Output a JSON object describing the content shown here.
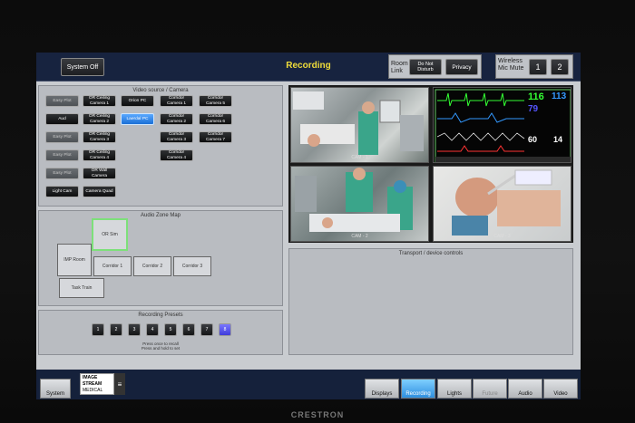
{
  "topbar": {
    "system_off": "System Off",
    "title": "Recording",
    "room_link_label": "Room Link",
    "do_not_disturb": "Do Not Disturb",
    "privacy": "Privacy",
    "wireless_mic_label": "Wireless Mic Mute",
    "mic1": "1",
    "mic2": "2"
  },
  "video_source": {
    "title": "Video source / Camera",
    "buttons": [
      {
        "label": "Easy Plot",
        "state": "dim"
      },
      {
        "label": "OR Ceiling Camera 1",
        "state": "normal"
      },
      {
        "label": "Orion PC",
        "state": "normal"
      },
      {
        "label": "Corridor Camera 1",
        "state": "normal"
      },
      {
        "label": "Corridor Camera 5",
        "state": "normal"
      },
      {
        "label": "Aud",
        "state": "normal"
      },
      {
        "label": "OR Ceiling Camera 2",
        "state": "normal"
      },
      {
        "label": "Laerdal PC",
        "state": "active"
      },
      {
        "label": "Corridor Camera 2",
        "state": "normal"
      },
      {
        "label": "Corridor Camera 6",
        "state": "normal"
      },
      {
        "label": "Easy Plot",
        "state": "dim"
      },
      {
        "label": "OR Ceiling Camera 3",
        "state": "normal"
      },
      {
        "label": "Corridor Camera 3",
        "state": "normal"
      },
      {
        "label": "Corridor Camera 7",
        "state": "normal"
      },
      {
        "label": "Easy Plot",
        "state": "dim"
      },
      {
        "label": "OR Ceiling Camera 4",
        "state": "normal"
      },
      {
        "label": "Corridor Camera 4",
        "state": "normal"
      },
      {
        "label": "Easy Plot",
        "state": "dim"
      },
      {
        "label": "OR Wall Camera",
        "state": "normal"
      },
      {
        "label": "Light Cam",
        "state": "normal"
      },
      {
        "label": "Camera Quad",
        "state": "normal"
      }
    ]
  },
  "audio_zone": {
    "title": "Audio Zone Map",
    "zones": [
      "OR Sim",
      "IMP Room",
      "Corridor 1",
      "Corridor 2",
      "Corridor 3",
      "Task Train"
    ]
  },
  "presets": {
    "title": "Recording Presets",
    "items": [
      "1",
      "2",
      "3",
      "4",
      "5",
      "6",
      "7",
      "8"
    ],
    "hint1": "Press once to recall",
    "hint2": "Press and hold to set"
  },
  "video": {
    "cam1": "CAM - 1",
    "cam2": "CAM - 2",
    "cam3": "CAM - 3",
    "vitals": {
      "hr": "116",
      "hr2": "113",
      "spo2": "79",
      "v60": "60",
      "v14": "14"
    }
  },
  "transport": {
    "title": "Transport / device controls"
  },
  "footer": {
    "system_tab": "System",
    "logo_line1": "IMAGE",
    "logo_line2": "STREAM",
    "logo_line3": "MEDICAL",
    "tabs": [
      {
        "label": "Displays",
        "state": "normal"
      },
      {
        "label": "Recording",
        "state": "active"
      },
      {
        "label": "Lights",
        "state": "normal"
      },
      {
        "label": "Future",
        "state": "dim"
      },
      {
        "label": "Audio",
        "state": "normal"
      },
      {
        "label": "Video",
        "state": "normal"
      }
    ]
  },
  "brand": "CRESTRON",
  "colors": {
    "title_yellow": "#f0dd3a",
    "active_blue": "#2f8fe0",
    "preset_active": "#4f4bea",
    "zone_selected": "#7de07a"
  }
}
